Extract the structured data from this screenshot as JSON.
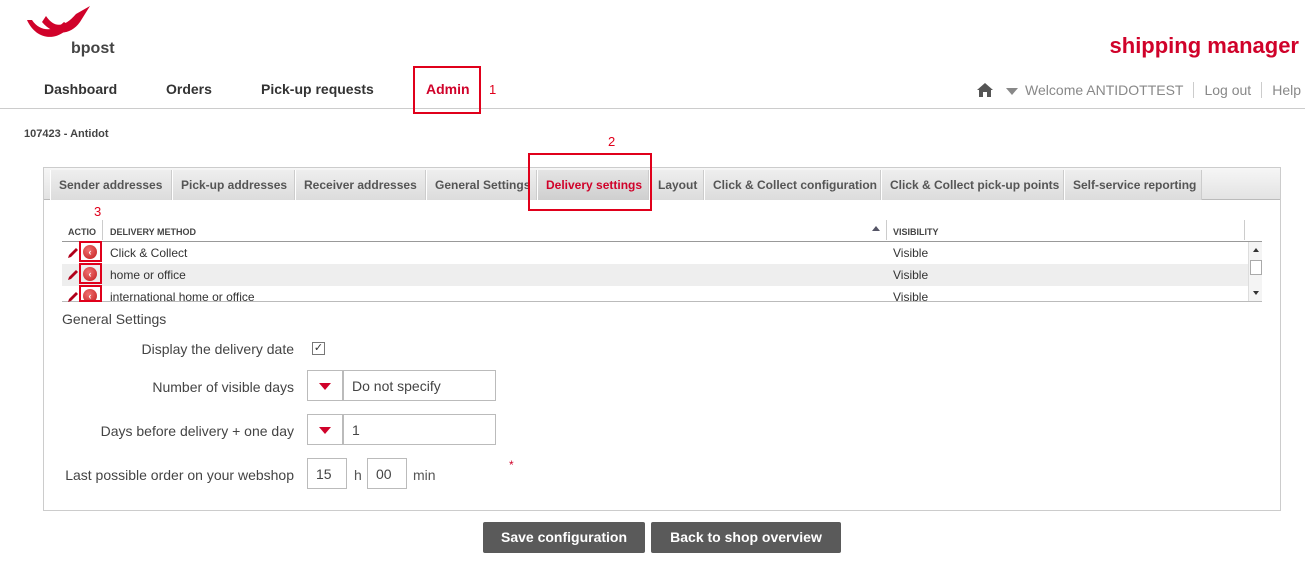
{
  "brand": {
    "logo_text": "bpost",
    "app_title": "shipping manager",
    "accent": "#d0022a"
  },
  "topnav": {
    "items": [
      "Dashboard",
      "Orders",
      "Pick-up requests",
      "Admin"
    ],
    "active": "Admin",
    "welcome": "Welcome ANTIDOTTEST",
    "logout": "Log out",
    "help": "Help"
  },
  "annotations": [
    "1",
    "2",
    "3"
  ],
  "shop": {
    "id_label": "107423 - Antidot"
  },
  "tabs": [
    "Sender addresses",
    "Pick-up addresses",
    "Receiver addresses",
    "General Settings",
    "Delivery settings",
    "Layout",
    "Click & Collect configuration",
    "Click & Collect pick-up points",
    "Self-service reporting"
  ],
  "active_tab": "Delivery settings",
  "grid": {
    "headers": [
      "ACTIO",
      "DELIVERY METHOD",
      "VISIBILITY"
    ],
    "rows": [
      {
        "method": "Click & Collect",
        "visibility": "Visible"
      },
      {
        "method": "home or office",
        "visibility": "Visible"
      },
      {
        "method": "international home or office",
        "visibility": "Visible"
      }
    ]
  },
  "settings": {
    "title": "General Settings",
    "display_date_label": "Display the delivery date",
    "display_date_checked": true,
    "visible_days_label": "Number of visible days",
    "visible_days_value": "Do not specify",
    "days_before_label": "Days before delivery + one day",
    "days_before_value": "1",
    "last_order_label": "Last possible order on your webshop",
    "last_order_hour": "15",
    "hour_unit": "h",
    "last_order_min": "00",
    "min_unit": "min",
    "required_mark": "*"
  },
  "buttons": {
    "save": "Save configuration",
    "back": "Back to shop overview"
  }
}
